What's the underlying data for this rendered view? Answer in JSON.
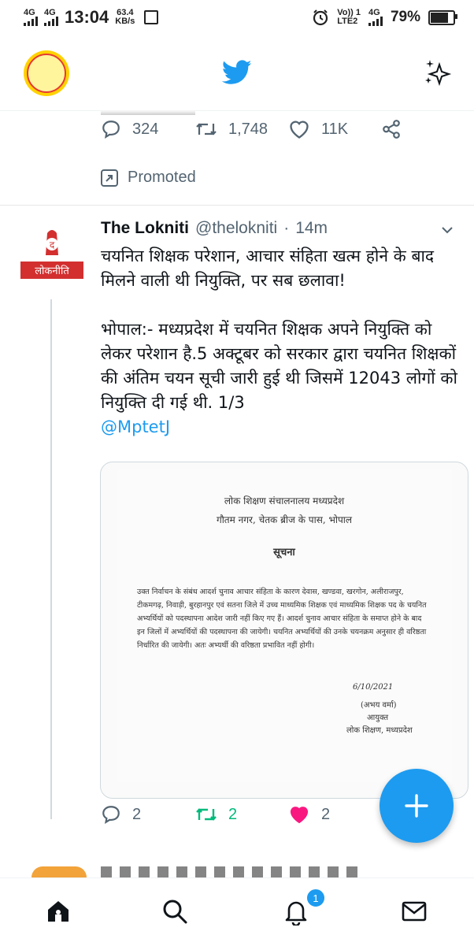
{
  "status_bar": {
    "net1": "4G",
    "net2": "4G",
    "time": "13:04",
    "speed_value": "63.4",
    "speed_unit": "KB/s",
    "volte": "Vo)) 1",
    "lte": "LTE2",
    "net3": "4G",
    "battery": "79%",
    "battery_level": 0.79
  },
  "prev_tweet": {
    "replies": "324",
    "retweets": "1,748",
    "likes": "11K",
    "promoted_label": "Promoted"
  },
  "tweet": {
    "name": "The Lokniti",
    "handle": "@thelokniti",
    "dot": "·",
    "time": "14m",
    "avatar_text": "लोकनीति",
    "text": "चयनित शिक्षक परेशान, आचार संहिता खत्म होने के बाद मिलने वाली थी नियुक्ति, पर सब छलावा!\n\nभोपाल:- मध्यप्रदेश में चयनित शिक्षक अपने नियुक्ति को लेकर परेशान है.5 अक्टूबर को सरकार द्वारा चयनित शिक्षकों की अंतिम चयन सूची जारी हुई थी जिसमें 12043 लोगों को नियुक्ति दी गई थी. 1/3",
    "mention": "@MptetJ",
    "replies": "2",
    "retweets": "2",
    "likes": "2"
  },
  "document": {
    "line1": "लोक शिक्षण संचालनालय मध्यप्रदेश",
    "line2": "गौतम नगर, चेतक ब्रीज के पास, भोपाल",
    "heading": "सूचना",
    "body": "उक्त निर्वाचन के संबंध आदर्श चुनाव आचार संहिता के कारण देवास, खण्डवा, खरगोन, अलीराजपुर, टीकमगढ़, निवाड़ी, बुरहानपुर एवं सतना जिले में उच्च माध्यमिक शिक्षक एवं माध्यमिक शिक्षक पद के चयनित अभ्यर्थियों को पदस्थापना आदेश जारी नहीं किए गए हैं। आदर्श चुनाव आचार संहिता के समाप्त होने के बाद इन जिलों में अभ्यर्थियों की पदस्थापना की जायेगी। चयनित अभ्यर्थियों की उनके चयनक्रम अनुसार ही वरिष्ठता निर्धारित की जायेगी। अतः अभ्यर्थी की वरिष्ठता प्रभावित नहीं होगी।",
    "sign_date": "6/10/2021",
    "sign_name": "(अभय वर्मा)",
    "sign_title": "आयुक्त",
    "sign_dept": "लोक शिक्षण, मध्यप्रदेश"
  },
  "nav": {
    "notifications_badge": "1"
  },
  "colors": {
    "accent": "#1d9bf0",
    "retweet_active": "#00ba7c",
    "like_active": "#f91880",
    "muted": "#536471"
  }
}
